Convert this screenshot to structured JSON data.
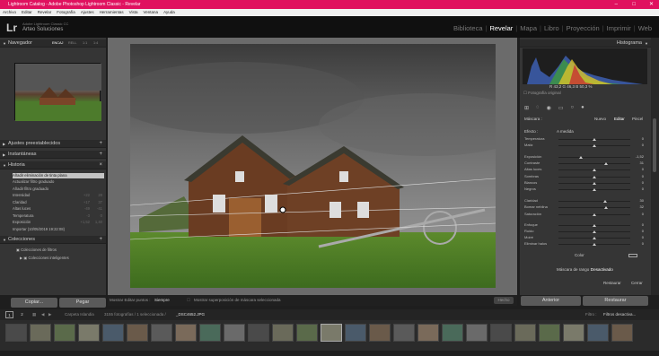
{
  "window": {
    "title": "Lightroom Catalog - Adobe Photoshop Lightroom Classic - Revelar",
    "minimize": "–",
    "maximize": "□",
    "close": "✕"
  },
  "menu": [
    "Archivo",
    "Editar",
    "Revelar",
    "Fotografía",
    "Ajustes",
    "Herramientas",
    "Vista",
    "Ventana",
    "Ayuda"
  ],
  "identity": {
    "logo": "Lr",
    "catalog": "Adobe Lightroom Classic CC",
    "user": "Arteo Soluciones"
  },
  "modules": [
    "Biblioteca",
    "Revelar",
    "Mapa",
    "Libro",
    "Proyección",
    "Imprimir",
    "Web"
  ],
  "left_panel": {
    "navigator": {
      "title": "Navegador",
      "zoom_options": [
        "ENCAJ",
        "RELL",
        "1:1",
        "1:4"
      ]
    },
    "presets": {
      "title": "Ajustes preestablecidos"
    },
    "snapshots": {
      "title": "Instantáneas"
    },
    "history": {
      "title": "Historia",
      "items": [
        {
          "label": "Añadir eliminación de tinta plana",
          "a": "",
          "b": ""
        },
        {
          "label": "Actualizar filtro graduado",
          "a": "",
          "b": ""
        },
        {
          "label": "Añadir filtro graduado",
          "a": "",
          "b": ""
        },
        {
          "label": "Intensidad",
          "a": "+22",
          "b": "28"
        },
        {
          "label": "Claridad",
          "a": "+17",
          "b": "37"
        },
        {
          "label": "Altas luces",
          "a": "-49",
          "b": "-41"
        },
        {
          "label": "Temperatura",
          "a": "-3",
          "b": "0"
        },
        {
          "label": "Exposición",
          "a": "+1,52",
          "b": "1,40"
        },
        {
          "label": "Importar (10/05/2019 19:22:08)",
          "a": "",
          "b": ""
        }
      ]
    },
    "collections": {
      "title": "Colecciones",
      "items": [
        "Colecciones de filtros",
        "Colecciones inteligentes"
      ]
    },
    "copy_button": "Copiar...",
    "paste_button": "Pegar"
  },
  "toolbar": {
    "edit_points_label": "Mostrar Editar puntos :",
    "edit_points_value": "Siempre",
    "overlay_label": "Mostrar superposición de máscara seleccionada",
    "done_button": "Hecho"
  },
  "right_panel": {
    "histogram_title": "Histograma",
    "readout": "R  43,2   G  46,3   B  50,3  %",
    "original_photo": "Fotografía original",
    "mask_label": "Máscara :",
    "mask_new": "Nuevo",
    "mask_edit": "Editar",
    "mask_brush": "Pincel",
    "effect_label": "Efecto :",
    "effect_value": "A medida",
    "sliders": [
      {
        "label": "Temperatura",
        "value": "0",
        "pos": 0.5
      },
      {
        "label": "Matiz",
        "value": "0",
        "pos": 0.5
      },
      {
        "label": "Exposición",
        "value": "-1,52",
        "pos": 0.31
      },
      {
        "label": "Contraste",
        "value": "31",
        "pos": 0.66
      },
      {
        "label": "Altas luces",
        "value": "0",
        "pos": 0.5
      },
      {
        "label": "Sombras",
        "value": "0",
        "pos": 0.5
      },
      {
        "label": "Blancos",
        "value": "0",
        "pos": 0.5
      },
      {
        "label": "Negros",
        "value": "0",
        "pos": 0.5
      },
      {
        "label": "Claridad",
        "value": "30",
        "pos": 0.65
      },
      {
        "label": "Bomar neblina",
        "value": "32",
        "pos": 0.66
      },
      {
        "label": "Saturación",
        "value": "0",
        "pos": 0.5
      },
      {
        "label": "Enfoque",
        "value": "0",
        "pos": 0.5
      },
      {
        "label": "Ruido",
        "value": "0",
        "pos": 0.5
      },
      {
        "label": "Moiré",
        "value": "0",
        "pos": 0.5
      },
      {
        "label": "Eliminar halos",
        "value": "0",
        "pos": 0.5
      }
    ],
    "color_label": "Color",
    "range_mask_label": "Máscara de rango :",
    "range_mask_value": "Desactivado",
    "restore": "Restaurar",
    "close": "Cerrar",
    "previous_button": "Anterior",
    "reset_button": "Restaurar"
  },
  "filmstrip_bar": {
    "pages": [
      "1",
      "2"
    ],
    "source": "Carpeta Islandia",
    "info": "3155 fotografías / 1 seleccionada /",
    "filename": "_DSC4652.JPG",
    "filter_label": "Filtro :",
    "filter_value": "Filtros desactiva..."
  },
  "colors": {
    "titlebar": "#e0115f",
    "accent_active_module": "#ffffff"
  }
}
